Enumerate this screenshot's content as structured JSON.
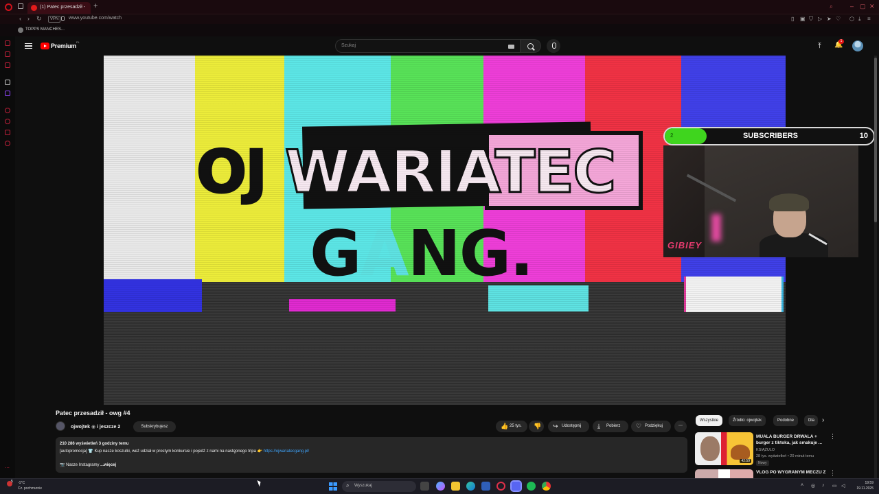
{
  "browser": {
    "tab_title": "(1) Patec przesadził -",
    "new_tab_icon": "plus-icon",
    "url": "www.youtube.com/watch",
    "vpn_label": "VPN",
    "bookmark": "TOPPS MANCHES..."
  },
  "youtube": {
    "logo_text": "Premium",
    "region": "PL",
    "search_placeholder": "Szukaj",
    "notification_count": "1"
  },
  "overlay": {
    "current": "2",
    "label": "SUBSCRIBERS",
    "goal": "10",
    "progress_fraction": 0.2,
    "cam_tag": "GIBIEY"
  },
  "video": {
    "title": "Patec przesadził - owg #4",
    "channel": "ojwojtek",
    "collab": "i jeszcze 2",
    "subscribe_label": "Subskrybujesz",
    "likes": "25 tys.",
    "share": "Udostępnij",
    "download": "Pobierz",
    "thanks": "Podziękuj"
  },
  "description": {
    "stats": "210 286 wyświetleń  3 godziny temu",
    "line2": "[autopromocja] 👕 Kup nasze koszulki, weź udział w prostym konkursie i pojedź z nami na następnego tripa 👉",
    "link": "https://ojwariatecgang.pl/",
    "line3": "📷 Nasze Instagramy",
    "more": "...więcej"
  },
  "related": {
    "chips": [
      "Wszystkie",
      "Źródło: ojwojtek",
      "Podobne",
      "Dla"
    ],
    "items": [
      {
        "title": "MUALA BURGER DRWALA + burger z tiktoka, jak smakuje ...",
        "channel": "KSIĄŻULO",
        "meta": "28 tys. wyświetleń • 20 minut temu",
        "badge": "Nowy",
        "duration": "42:59"
      },
      {
        "title": "VLOG PO WYGRANYM MECZU Z"
      }
    ]
  },
  "taskbar": {
    "weather_temp": "-1°C",
    "weather_cond": "Cz. pochmurnie",
    "weather_badge": "5",
    "search_label": "Wyszukaj",
    "time": "19:59",
    "date": "19.11.2025"
  },
  "colors": {
    "youtube_red": "#ff0000",
    "progress_green": "#3fd51e",
    "opera_red": "#d0121b",
    "link_blue": "#3ea6ff"
  }
}
